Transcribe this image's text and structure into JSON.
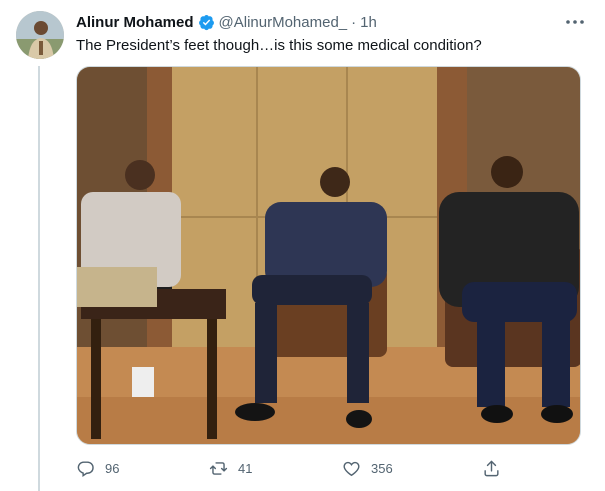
{
  "tweet": {
    "author_name": "Alinur Mohamed",
    "handle": "@AlinurMohamed_",
    "separator": "·",
    "time": "1h",
    "text": "The President’s feet though…is this some medical condition?",
    "verified": true
  },
  "actions": {
    "replies": "96",
    "retweets": "41",
    "likes": "356"
  },
  "icons": {
    "more": "more-icon",
    "reply": "reply-icon",
    "retweet": "retweet-icon",
    "like": "heart-icon",
    "share": "share-icon",
    "verified": "verified-badge-icon"
  },
  "colors": {
    "verified_blue": "#1d9bf0",
    "secondary_text": "#536471",
    "primary_text": "#0f1419"
  }
}
